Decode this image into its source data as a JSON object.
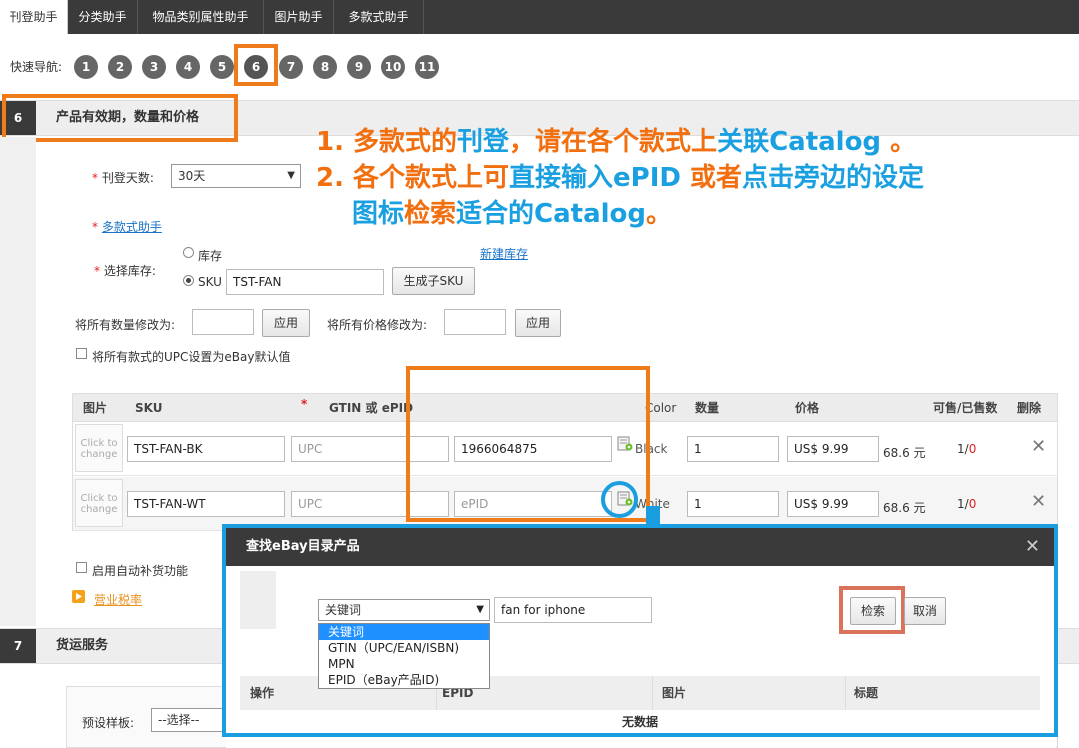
{
  "tabs": [
    {
      "label": "刊登助手",
      "active": true
    },
    {
      "label": "分类助手",
      "active": false
    },
    {
      "label": "物品类别属性助手",
      "active": false
    },
    {
      "label": "图片助手",
      "active": false
    },
    {
      "label": "多款式助手",
      "active": false
    }
  ],
  "quick_nav": {
    "label": "快速导航:",
    "items": [
      "1",
      "2",
      "3",
      "4",
      "5",
      "6",
      "7",
      "8",
      "9",
      "10",
      "11"
    ],
    "selected": "6"
  },
  "section6": {
    "num": "6",
    "title": "产品有效期，数量和价格",
    "duration_label": "刊登天数:",
    "duration_value": "30天",
    "variation_helper_link": "多款式助手",
    "inventory_label": "选择库存:",
    "opt_stock": "库存",
    "opt_sku": "SKU",
    "new_inventory_link": "新建库存",
    "sku_value": "TST-FAN",
    "gen_sku_button": "生成子SKU",
    "bulk_qty_label": "将所有数量修改为:",
    "bulk_qty_value": "",
    "apply_label": "应用",
    "bulk_price_label": "将所有价格修改为:",
    "bulk_price_value": "",
    "upc_default_label": "将所有款式的UPC设置为eBay默认值",
    "auto_restock_label": "启用自动补货功能",
    "sales_tax_link": "营业税率"
  },
  "variants_table": {
    "headers": {
      "image": "图片",
      "sku": "SKU",
      "gtin": "GTIN 或 ePID",
      "color": "Color",
      "qty": "数量",
      "price": "价格",
      "sold": "可售/已售数",
      "delete": "删除"
    },
    "rows": [
      {
        "thumb": "Click to change",
        "sku": "TST-FAN-BK",
        "upc_placeholder": "UPC",
        "epid": "1966064875",
        "epid_placeholder": "",
        "color": "Black",
        "qty": "1",
        "price": "US$ 9.99",
        "local_price": "68.6 元",
        "avail": "1",
        "sold": "0"
      },
      {
        "thumb": "Click to change",
        "sku": "TST-FAN-WT",
        "upc_placeholder": "UPC",
        "epid": "",
        "epid_placeholder": "ePID",
        "color": "White",
        "qty": "1",
        "price": "US$ 9.99",
        "local_price": "68.6 元",
        "avail": "1",
        "sold": "0"
      }
    ]
  },
  "section7": {
    "num": "7",
    "title": "货运服务",
    "preset_label": "预设样板:",
    "preset_value": "--选择--"
  },
  "annotation": {
    "line1_a": "1. 多款式的",
    "line1_b": "刊登",
    "line1_c": "，请在各个款式上",
    "line1_d": "关联Catalog",
    "line1_e": " 。",
    "line2_a": "2. 各个款式上可",
    "line2_b": "直接输入ePID",
    "line2_c": " 或者",
    "line2_d": "点击旁边的设定",
    "line3_a": "图标",
    "line3_b": "检索",
    "line3_c": "适合的Catalog",
    "line3_d": "。"
  },
  "modal": {
    "title": "查找eBay目录产品",
    "search_type_value": "关键词",
    "search_type_options": [
      "关键词",
      "GTIN（UPC/EAN/ISBN)",
      "MPN",
      "EPID（eBay产品ID)"
    ],
    "keyword_value": "fan for iphone",
    "search_button": "检索",
    "cancel_button": "取消",
    "table_headers": {
      "action": "操作",
      "epid": "EPID",
      "image": "图片",
      "title": "标题"
    },
    "empty_text": "无数据"
  },
  "colors": {
    "annotation_orange": "#f07b1a",
    "annotation_blue": "#1aa0e0",
    "search_highlight": "#d9735c",
    "dark_bar": "#3a3a3a",
    "link_blue": "#1a73c8"
  }
}
